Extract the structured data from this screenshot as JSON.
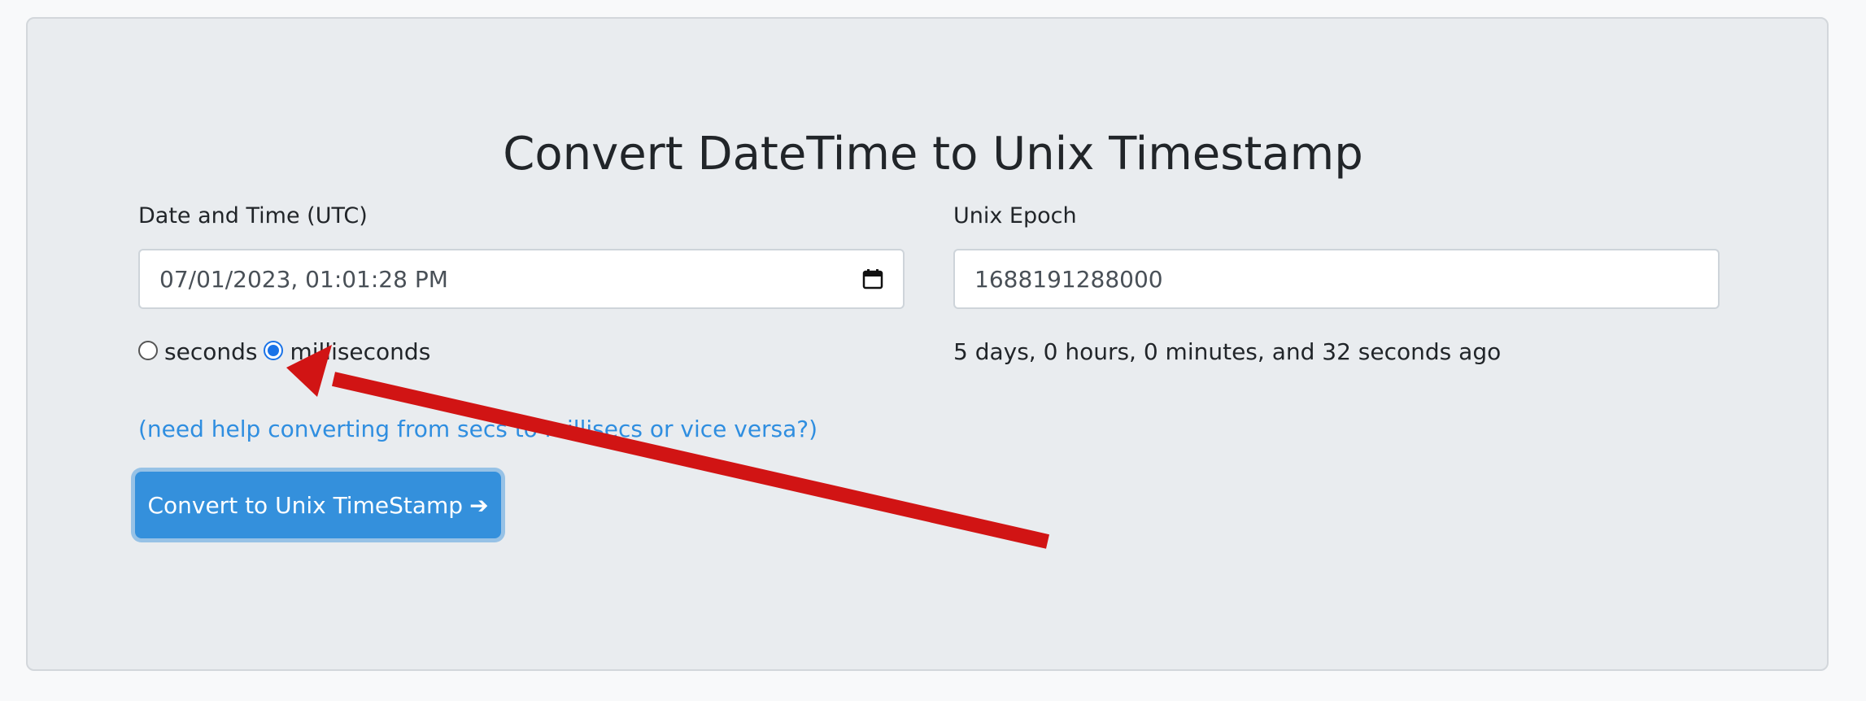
{
  "page": {
    "title": "Convert DateTime to Unix Timestamp"
  },
  "datetime": {
    "label": "Date and Time (UTC)",
    "value": "07/01/2023, 01:01:28 PM"
  },
  "epoch": {
    "label": "Unix Epoch",
    "value": "1688191288000",
    "relative": "5 days, 0 hours, 0 minutes, and 32 seconds ago"
  },
  "units": {
    "seconds_label": "seconds",
    "milliseconds_label": "milliseconds",
    "selected": "milliseconds"
  },
  "help": {
    "link_text": "(need help converting from secs to millisecs or vice versa?)"
  },
  "convert": {
    "button_label": "Convert to Unix TimeStamp",
    "icon": "arrow-right-icon",
    "icon_glyph": "➔"
  },
  "colors": {
    "panel_bg": "#e9ecef",
    "accent": "#3490dc",
    "link": "#2f8ee0",
    "annotation_arrow": "#d11414"
  }
}
